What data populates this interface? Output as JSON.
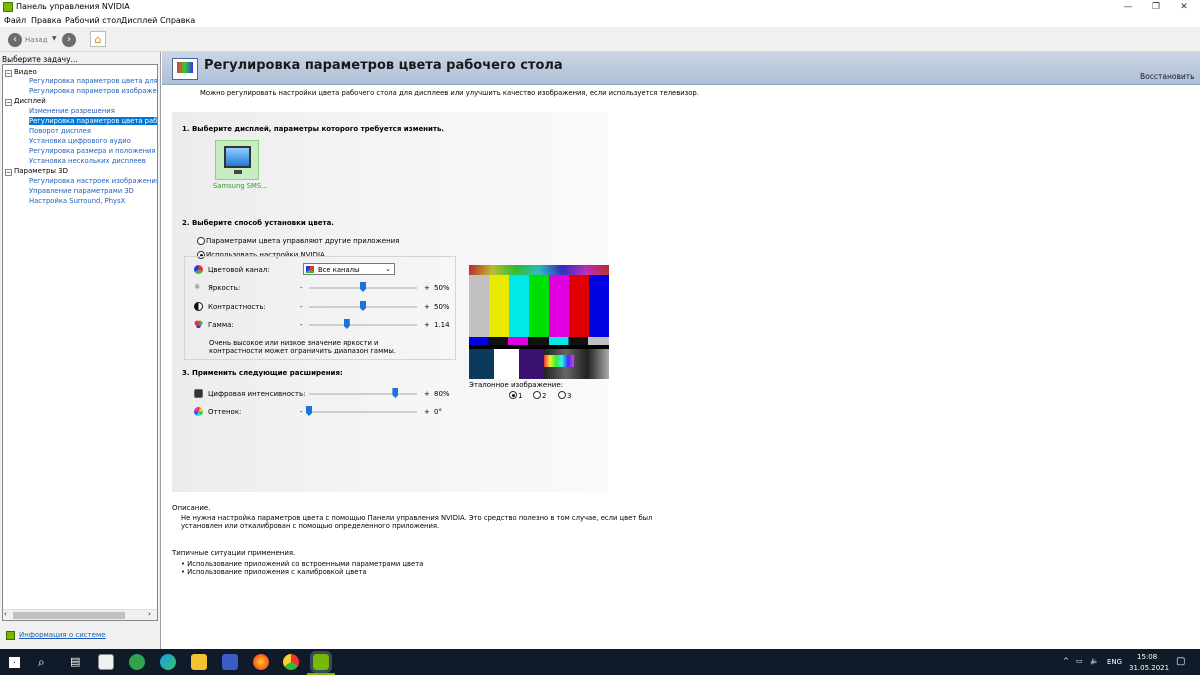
{
  "window": {
    "title": "Панель управления NVIDIA"
  },
  "menu": [
    "Файл",
    "Правка",
    "Рабочий стол",
    "Дисплей",
    "Справка"
  ],
  "toolbar": {
    "back_label": "Назад"
  },
  "left": {
    "heading": "Выберите задачу...",
    "tree": [
      {
        "label": "Видео",
        "children": [
          "Регулировка параметров цвета для вид",
          "Регулировка параметров изображения д"
        ]
      },
      {
        "label": "Дисплей",
        "children": [
          "Изменение разрешения",
          "Регулировка параметров цвета рабочег",
          "Поворот дисплея",
          "Установка цифрового аудио",
          "Регулировка размера и положения рабо",
          "Установка нескольких дисплеев"
        ]
      },
      {
        "label": "Параметры 3D",
        "children": [
          "Регулировка настроек изображения с пр",
          "Управление параметрами 3D",
          "Настройка Surround, PhysX"
        ]
      }
    ],
    "system_info": "Информация о системе"
  },
  "main": {
    "title": "Регулировка параметров цвета рабочего стола",
    "restore": "Восстановить",
    "intro": "Можно регулировать настройки цвета рабочего стола для дисплеев или улучшить качество изображения, если используется телевизор.",
    "step1": "1. Выберите дисплей, параметры которого требуется изменить.",
    "display_name": "Samsung SMS...",
    "step2": "2. Выберите способ установки цвета.",
    "radio_other": "Параметрами цвета управляют другие приложения",
    "radio_nvidia": "Использовать настройки NVIDIA",
    "channel_label": "Цветовой канал:",
    "channel_value": "Все каналы",
    "brightness_label": "Яркость:",
    "brightness_value": "50%",
    "contrast_label": "Контрастность:",
    "contrast_value": "50%",
    "gamma_label": "Гамма:",
    "gamma_value": "1.14",
    "warning_line1": "Очень высокое или низкое значение яркости и",
    "warning_line2": "контрастности может ограничить диапазон гаммы.",
    "step3": "3. Применить следующие расширения:",
    "vibrance_label": "Цифровая интенсивность:",
    "vibrance_value": "80%",
    "hue_label": "Оттенок:",
    "hue_value": "0°",
    "minus": "-",
    "plus": "+",
    "reference_label": "Эталонное изображение:",
    "ref_options": [
      "1",
      "2",
      "3"
    ],
    "sliders": {
      "brightness": 0.5,
      "contrast": 0.5,
      "gamma": 0.35,
      "vibrance": 0.8,
      "hue": 0.0
    }
  },
  "description": {
    "heading": "Описание.",
    "line1": "Не нужна настройка параметров цвета с помощью Панели управления NVIDIA. Это средство полезно в том случае, если цвет был",
    "line2": "установлен или откалиброван с помощью определенного приложения.",
    "usage_heading": "Типичные ситуации применения.",
    "usage1": "Использование приложений со встроенными параметрами цвета",
    "usage2": "Использование приложения с калибровкой цвета"
  },
  "taskbar": {
    "lang": "ENG",
    "time": "15:08",
    "date": "31.05.2021"
  }
}
